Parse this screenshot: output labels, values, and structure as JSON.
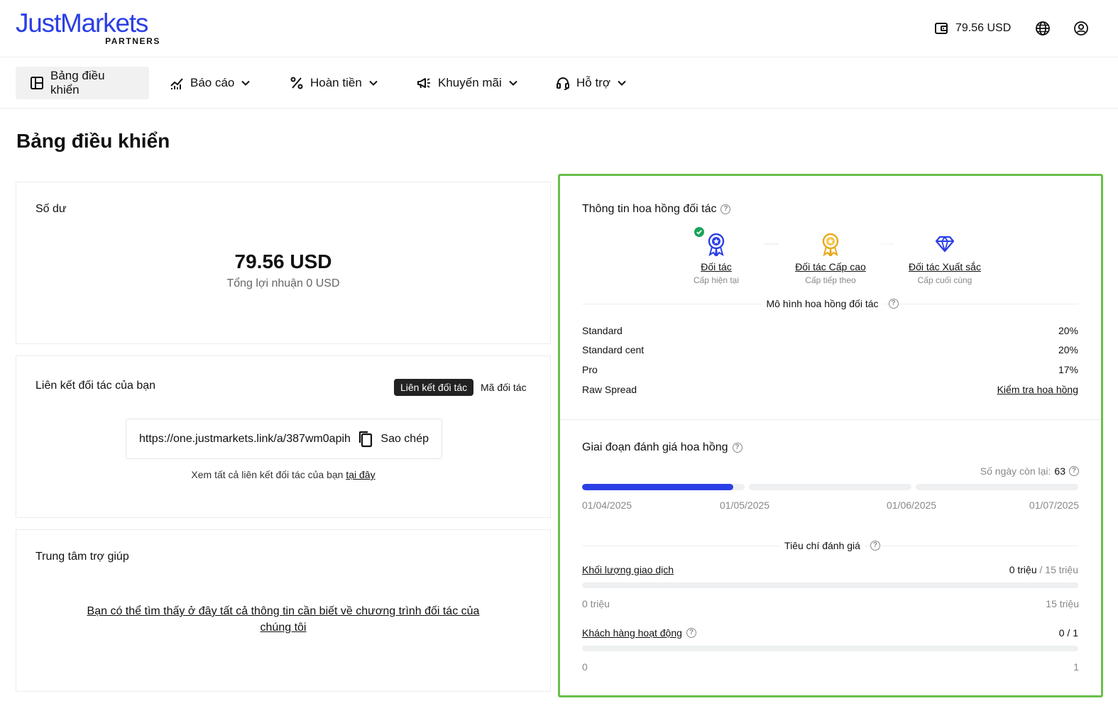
{
  "brand": {
    "name": "JustMarkets",
    "sub": "PARTNERS",
    "color": "#2b3fe6"
  },
  "header": {
    "balance": "79.56 USD",
    "icons": [
      "wallet-icon",
      "globe-icon",
      "user-icon"
    ]
  },
  "nav": {
    "items": [
      {
        "label": "Bảng điều khiển",
        "icon": "dashboard-icon",
        "active": true
      },
      {
        "label": "Báo cáo",
        "icon": "chart-icon"
      },
      {
        "label": "Hoàn tiền",
        "icon": "percent-icon"
      },
      {
        "label": "Khuyến mãi",
        "icon": "megaphone-icon"
      },
      {
        "label": "Hỗ trợ",
        "icon": "headset-icon"
      }
    ]
  },
  "page": {
    "title": "Bảng điều khiển"
  },
  "balance_card": {
    "title": "Số dư",
    "value": "79.56 USD",
    "sub": "Tổng lợi nhuận 0 USD"
  },
  "link_card": {
    "title": "Liên kết đối tác của bạn",
    "toggle_on": "Liên kết đối tác",
    "toggle_off": "Mã đối tác",
    "url": "https://one.justmarkets.link/a/387wm0apih",
    "copy_label": "Sao chép",
    "note_prefix": "Xem tất cả liên kết đối tác của bạn",
    "note_link": "tại đây"
  },
  "help_card": {
    "title": "Trung tâm trợ giúp",
    "text": "Bạn có thể tìm thấy ở đây tất cả thông tin cần biết về chương trình đối tác của chúng tôi"
  },
  "commission": {
    "title": "Thông tin hoa hồng đối tác",
    "tiers": [
      {
        "name": "Đối tác",
        "sub": "Cấp hiện tại",
        "icon": "medal-blue-icon",
        "current": true
      },
      {
        "name": "Đối tác Cấp cao",
        "sub": "Cấp tiếp theo",
        "icon": "medal-gold-icon"
      },
      {
        "name": "Đối tác Xuất sắc",
        "sub": "Cấp cuối cùng",
        "icon": "diamond-icon"
      }
    ],
    "model_title": "Mô hình hoa hồng đối tác",
    "rates": [
      {
        "name": "Standard",
        "value": "20%"
      },
      {
        "name": "Standard cent",
        "value": "20%"
      },
      {
        "name": "Pro",
        "value": "17%"
      },
      {
        "name": "Raw Spread",
        "value": "Kiểm tra hoa hồng"
      }
    ]
  },
  "evaluation": {
    "title": "Giai đoạn đánh giá hoa hồng",
    "days_left_label": "Số ngày còn lại:",
    "days_left": "63",
    "progress_fraction": 0.31,
    "dates": [
      "01/04/2025",
      "01/05/2025",
      "01/06/2025",
      "01/07/2025"
    ],
    "criteria_title": "Tiêu chí đánh giá",
    "criteria": [
      {
        "name": "Khối lượng giao dịch",
        "current": "0 triệu",
        "target": "15 triệu",
        "min": "0 triệu",
        "max": "15 triệu",
        "fraction": 0
      },
      {
        "name": "Khách hàng hoạt động",
        "current": "0 / 1",
        "min": "0",
        "max": "1",
        "fraction": 0
      }
    ]
  }
}
